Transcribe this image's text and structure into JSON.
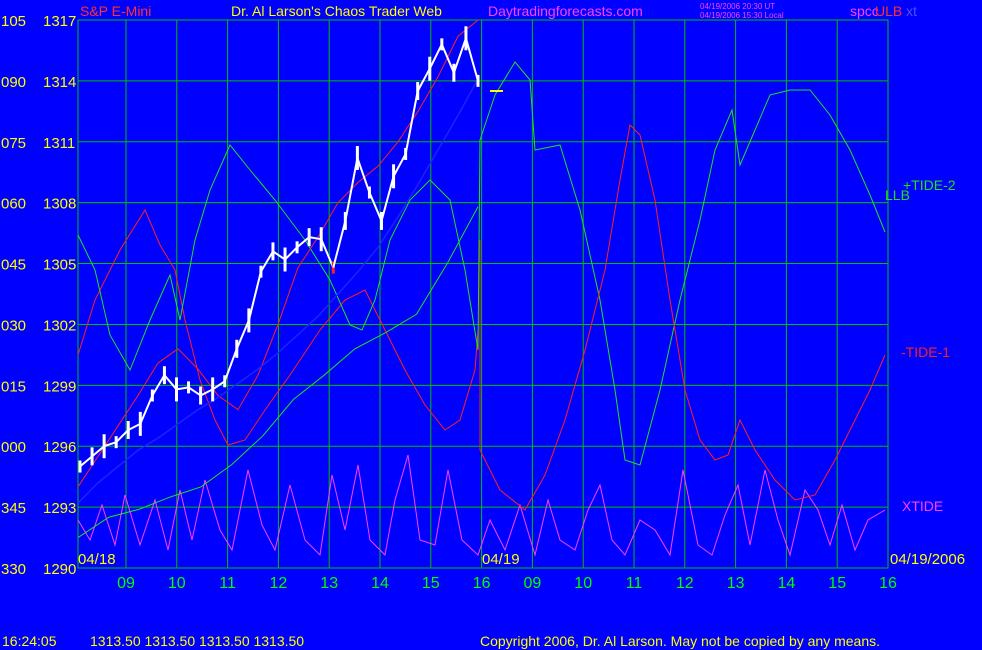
{
  "header": {
    "instrument": "S&P E-Mini",
    "title": "Dr. Al Larson's Chaos Trader Web",
    "site": "Daytradingforecasts.com",
    "timestamp_ut": "04/19/2006 20:30 UT",
    "timestamp_local": "04/19/2006 15:30 Local",
    "source": "spcc",
    "overlay": "ULB",
    "overlay2": "xt"
  },
  "footer": {
    "time": "16:24:05",
    "quote": "1313.50 1313.50 1313.50 1313.50",
    "copyright": "Copyright 2006, Dr. Al Larson. May not be copied by any means."
  },
  "colors": {
    "background": "#0000ff",
    "grid": "#00c000",
    "price": "#ffffff",
    "tide1": "#ff2020",
    "tide2": "#20e020",
    "xtide": "#ff40ff",
    "llb": "#2020ff",
    "axis_text_left": "#ffff00",
    "axis_text_bottom": "#00ff00"
  },
  "chart_data": {
    "type": "line",
    "y_left_labels": [
      "105",
      "090",
      "075",
      "060",
      "045",
      "030",
      "015",
      "000",
      "345",
      "330"
    ],
    "y_right_labels": [
      "1317",
      "1314",
      "1311",
      "1308",
      "1305",
      "1302",
      "1299",
      "1296",
      "1293",
      "1290"
    ],
    "x_labels": [
      "09",
      "10",
      "11",
      "12",
      "13",
      "14",
      "15",
      "16",
      "09",
      "10",
      "11",
      "12",
      "13",
      "14",
      "15",
      "16"
    ],
    "date_labels": [
      "04/18",
      "04/19",
      "04/19/2006"
    ],
    "ylim": [
      1290,
      1317
    ],
    "series_labels": {
      "tide2": "+TIDE-2",
      "llb": "LLB",
      "tide1": "-TIDE-1",
      "xtide": "XTIDE"
    },
    "price_close": [
      1295,
      1295.5,
      1296,
      1296.2,
      1296.8,
      1297.1,
      1298.5,
      1299.5,
      1298.8,
      1298.9,
      1298.5,
      1298.8,
      1299.2,
      1300.8,
      1302.2,
      1304.6,
      1305.6,
      1305.2,
      1305.8,
      1306.3,
      1306.2,
      1304.8,
      1307.1,
      1310.2,
      1308.5,
      1307.1,
      1309.3,
      1310.4,
      1313.5,
      1314.6,
      1315.8,
      1314.4,
      1316.1,
      1314.0
    ],
    "series": [
      {
        "key": "tide1",
        "values": [
          1294,
          1295.5,
          1297,
          1298.5,
          1300.1,
          1300.8,
          1299.8,
          1298.5,
          1297.8,
          1299.5,
          1302.0,
          1304.8,
          1306.3,
          1308.0,
          1309.0,
          1309.8,
          1311.0,
          1312.5,
          1314.2,
          1316.2,
          1317.0
        ]
      },
      {
        "key": "llb",
        "values": [
          1293.2,
          1294.2,
          1295.0,
          1295.8,
          1296.4,
          1297.1,
          1297.8,
          1298.4,
          1299.1,
          1299.8,
          1300.6,
          1301.5,
          1302.4,
          1303.5,
          1304.6,
          1305.8,
          1307.3,
          1308.9,
          1310.6,
          1312.3,
          1314.1
        ]
      },
      {
        "key": "tide2",
        "values": [
          1291.5,
          1292.5,
          1292.9,
          1293.5,
          1294.0,
          1295.1,
          1296.5,
          1298.3,
          1299.5,
          1300.8,
          1301.6,
          1302.5,
          1305.0,
          1307.8
        ]
      }
    ]
  }
}
